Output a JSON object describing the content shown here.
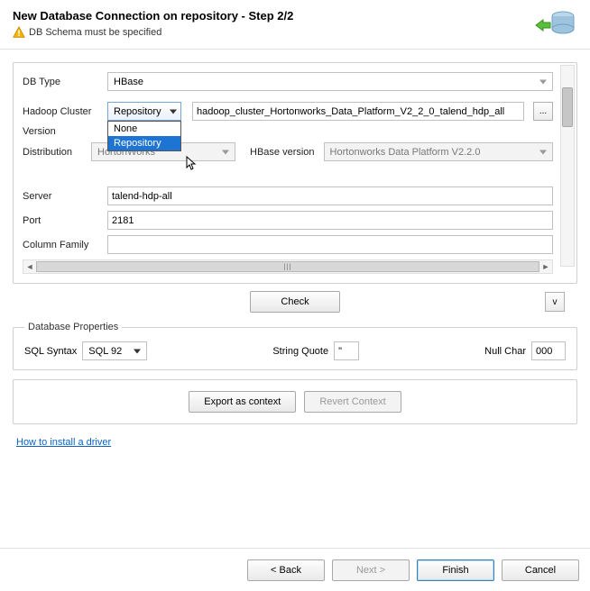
{
  "header": {
    "title": "New Database Connection on repository - Step 2/2",
    "warning": "DB Schema must be specified"
  },
  "form": {
    "db_type_label": "DB Type",
    "db_type_value": "HBase",
    "hadoop_cluster_label": "Hadoop Cluster",
    "hadoop_cluster_value": "Repository",
    "hadoop_cluster_options": [
      "None",
      "Repository"
    ],
    "hadoop_cluster_selected_index": 1,
    "cluster_path_value": "hadoop_cluster_Hortonworks_Data_Platform_V2_2_0_talend_hdp_all",
    "browse_label": "...",
    "version_label": "Version",
    "distribution_label": "Distribution",
    "distribution_value": "HortonWorks",
    "hbase_version_label": "HBase version",
    "hbase_version_value": "Hortonworks Data Platform V2.2.0",
    "server_label": "Server",
    "server_value": "talend-hdp-all",
    "port_label": "Port",
    "port_value": "2181",
    "column_family_label": "Column Family",
    "column_family_value": ""
  },
  "buttons": {
    "check": "Check",
    "v_button": "v",
    "export_context": "Export as context",
    "revert_context": "Revert Context",
    "back": "< Back",
    "next": "Next >",
    "finish": "Finish",
    "cancel": "Cancel"
  },
  "db_props": {
    "legend": "Database Properties",
    "sql_syntax_label": "SQL Syntax",
    "sql_syntax_value": "SQL 92",
    "string_quote_label": "String Quote",
    "string_quote_value": "\"",
    "null_char_label": "Null Char",
    "null_char_value": "000"
  },
  "link": {
    "install_driver": "How to install a driver"
  }
}
